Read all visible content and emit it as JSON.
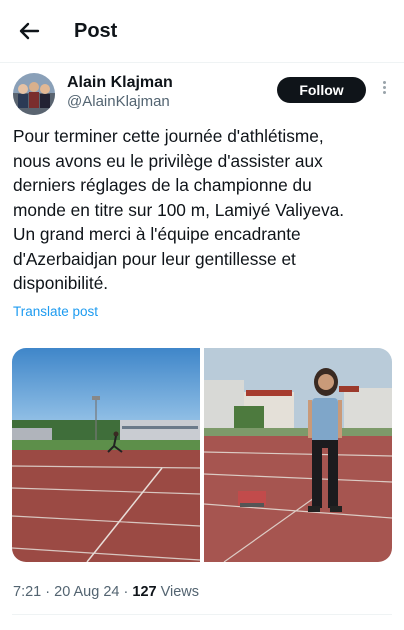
{
  "header": {
    "title": "Post"
  },
  "author": {
    "name": "Alain Klajman",
    "handle": "@AlainKlajman",
    "follow_label": "Follow"
  },
  "tweet": {
    "text": "Pour terminer cette journée d'athlétisme,\nnous avons eu le privilège d'assister aux\nderniers réglages de la championne du\nmonde en titre sur 100 m,  Lamiyé Valiyeva.\nUn grand merci à l'équipe encadrante\nd'Azerbaidjan pour leur gentillesse et\ndisponibilité.",
    "translate_label": "Translate post"
  },
  "meta": {
    "time": "7:21",
    "date": "20 Aug 24",
    "views_count": "127",
    "views_label": "Views"
  },
  "colors": {
    "link": "#1d9bf0",
    "follow_bg": "#0f1419",
    "track": "#9b4a44"
  }
}
